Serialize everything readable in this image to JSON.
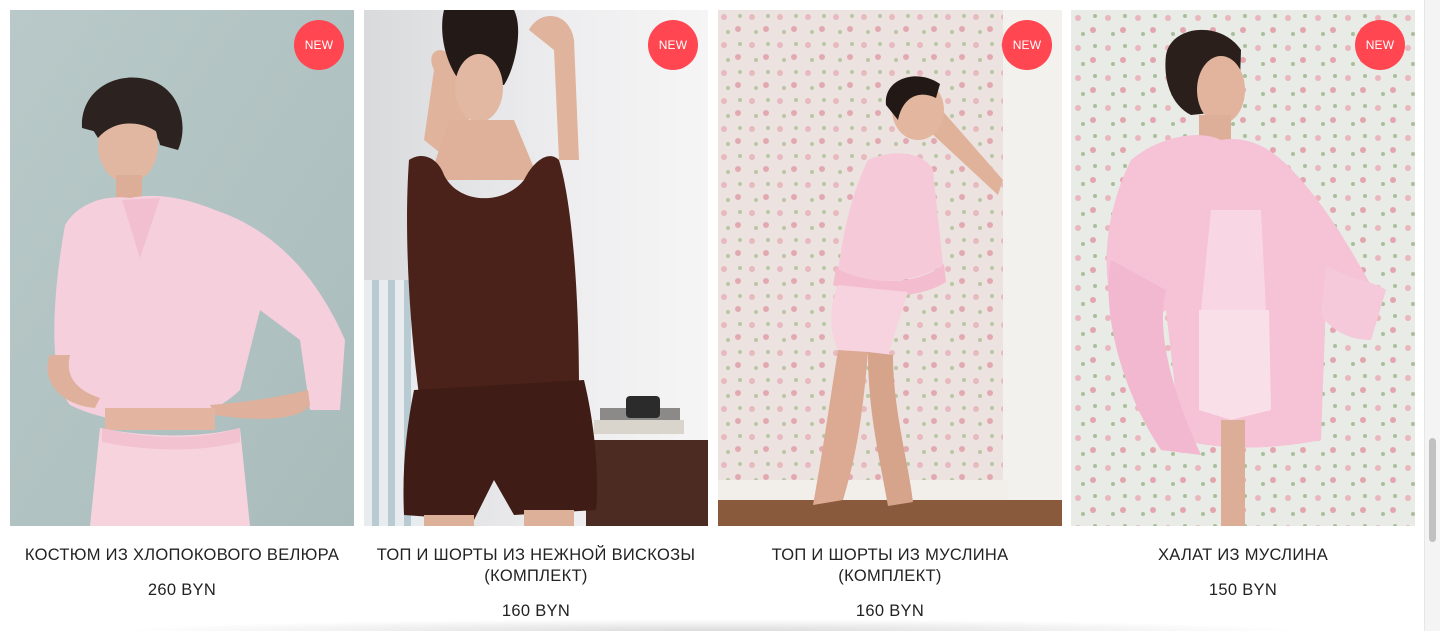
{
  "products": [
    {
      "title": "КОСТЮМ ИЗ ХЛОПОКОВОГО ВЕЛЮРА",
      "price": "260 BYN",
      "badge": "NEW",
      "image_alt": "model in pink velour shirt and pants"
    },
    {
      "title": "ТОП И ШОРТЫ ИЗ НЕЖНОЙ ВИСКОЗЫ (КОМПЛЕКТ)",
      "price": "160 BYN",
      "badge": "NEW",
      "image_alt": "model in brown viscose top and shorts"
    },
    {
      "title": "ТОП И ШОРТЫ ИЗ МУСЛИНА (КОМПЛЕКТ)",
      "price": "160 BYN",
      "badge": "NEW",
      "image_alt": "model in pink muslin top and shorts against floral wallpaper"
    },
    {
      "title": "ХАЛАТ ИЗ МУСЛИНА",
      "price": "150 BYN",
      "badge": "NEW",
      "image_alt": "model in pink muslin robe against floral wallpaper"
    }
  ],
  "colors": {
    "badge": "#ff4651",
    "text": "#222222",
    "pink_garment": "#f7c9d8",
    "brown_garment": "#4a2219"
  }
}
